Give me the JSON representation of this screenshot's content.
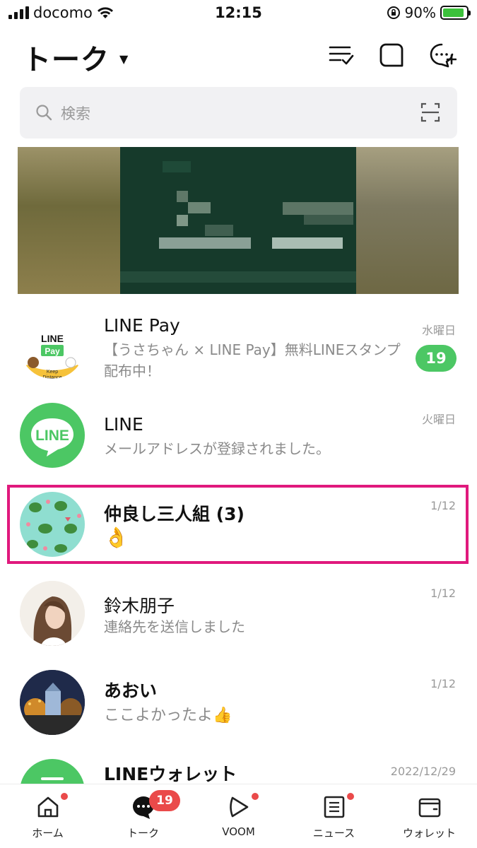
{
  "status_bar": {
    "carrier": "docomo",
    "time": "12:15",
    "battery_percent": "90%",
    "battery_level": 0.9
  },
  "header": {
    "title": "トーク"
  },
  "search": {
    "placeholder": "検索"
  },
  "chats": [
    {
      "name": "LINE Pay",
      "message": "【うさちゃん × LINE Pay】無料LINEスタンプ配布中！",
      "date": "水曜日",
      "unread": "19",
      "avatar_text": [
        "LINE",
        "Pay",
        "Keep",
        "Distance"
      ]
    },
    {
      "name": "LINE",
      "message": "メールアドレスが登録されました。",
      "date": "火曜日",
      "avatar_text": "LINE"
    },
    {
      "name": "仲良し三人組 (3)",
      "message": "👌",
      "date": "1/12"
    },
    {
      "name": "鈴木朋子",
      "message": "連絡先を送信しました",
      "date": "1/12"
    },
    {
      "name": "あおい",
      "message": "ここよかったよ👍",
      "date": "1/12"
    },
    {
      "name": "LINEウォレット",
      "message": "",
      "date": "2022/12/29"
    }
  ],
  "tabs": [
    {
      "label": "ホーム",
      "icon": "home-icon",
      "dot": true
    },
    {
      "label": "トーク",
      "icon": "chat-bubble-icon",
      "badge": "19"
    },
    {
      "label": "VOOM",
      "icon": "voom-play-icon",
      "dot": true
    },
    {
      "label": "ニュース",
      "icon": "news-icon",
      "dot": true
    },
    {
      "label": "ウォレット",
      "icon": "wallet-icon",
      "dot": false
    }
  ],
  "colors": {
    "line_green": "#4cc764",
    "badge_red": "#ea4a4a",
    "highlight_pink": "#e0197d"
  }
}
